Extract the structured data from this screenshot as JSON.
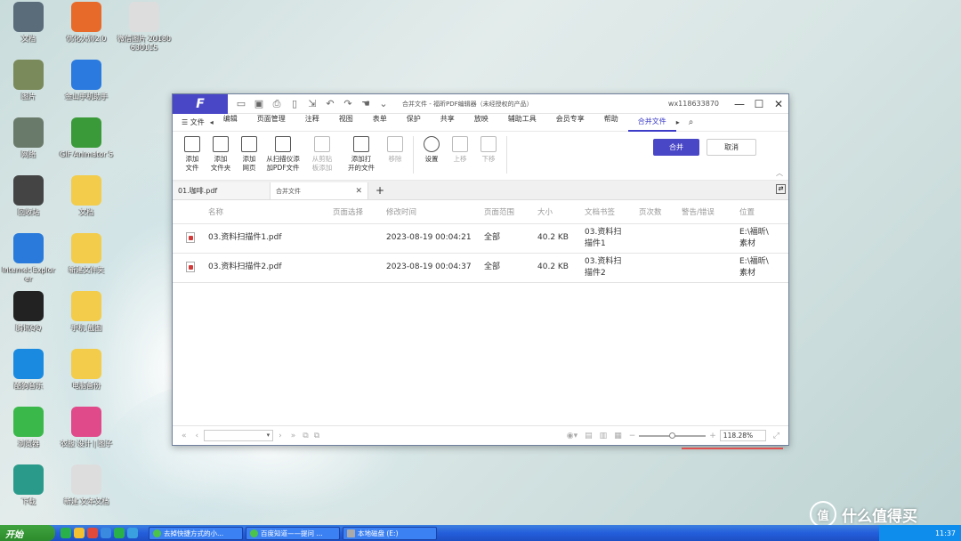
{
  "desktop": {
    "icons": [
      {
        "label": "文档",
        "color": "#5a6b7a",
        "glyph": "computer-icon"
      },
      {
        "label": "图片",
        "color": "#7a8a5a",
        "glyph": "photos-icon"
      },
      {
        "label": "网络",
        "color": "#6a7a6a",
        "glyph": "network-icon"
      },
      {
        "label": "回收站",
        "color": "#444444",
        "glyph": "recycle-bin-icon"
      },
      {
        "label": "Internet Explorer",
        "color": "#2a7adb",
        "glyph": "ie-icon"
      },
      {
        "label": "腾讯QQ",
        "color": "#222222",
        "glyph": "qq-icon"
      },
      {
        "label": "酷狗音乐",
        "color": "#1a8ae0",
        "glyph": "kugou-icon"
      },
      {
        "label": "浏览器",
        "color": "#3bb84a",
        "glyph": "browser-icon"
      },
      {
        "label": "下载",
        "color": "#2a9a8a",
        "glyph": "download-icon"
      },
      {
        "label": "优化大师2.0",
        "color": "#e86a2a",
        "glyph": "browser-icon"
      },
      {
        "label": "金山手机助手",
        "color": "#2a7ae0",
        "glyph": "phone-icon"
      },
      {
        "label": "GIF Animator 5",
        "color": "#3a9a3a",
        "glyph": "gif-icon"
      },
      {
        "label": "文档",
        "color": "#f2cc4a",
        "glyph": "folder-icon"
      },
      {
        "label": "新建文件夹",
        "color": "#f2cc4a",
        "glyph": "folder-icon"
      },
      {
        "label": "手机 截图",
        "color": "#f2cc4a",
        "glyph": "folder-icon"
      },
      {
        "label": "电脑备份",
        "color": "#f2cc4a",
        "glyph": "folder-icon"
      },
      {
        "label": "衣服 设计 | 图子",
        "color": "#e04a8a",
        "glyph": "shirt-icon"
      },
      {
        "label": "新建 文本文档",
        "color": "#dddddd",
        "glyph": "text-file-icon"
      },
      {
        "label": "微信图片 20180630115",
        "color": "#dddddd",
        "glyph": "image-file-icon"
      }
    ]
  },
  "window": {
    "logo": "F",
    "title": "合并文件 - 福昕PDF编辑器（未经授权的产品）",
    "user": "wx118633870",
    "menu": {
      "file": "文件",
      "items": [
        "编辑",
        "页面管理",
        "注释",
        "视图",
        "表单",
        "保护",
        "共享",
        "放映",
        "辅助工具",
        "会员专享",
        "帮助",
        "合并文件"
      ],
      "active_index": 11
    },
    "ribbon": {
      "buttons": [
        {
          "label": "添加\n文件",
          "disabled": false
        },
        {
          "label": "添加\n文件夹",
          "disabled": false
        },
        {
          "label": "添加\n网页",
          "disabled": false
        },
        {
          "label": "从扫描仪添\n加PDF文件",
          "disabled": false
        },
        {
          "label": "从剪贴\n板添加",
          "disabled": true
        },
        {
          "label": "添加打\n开的文件",
          "disabled": false
        },
        {
          "label": "移除",
          "disabled": true
        },
        {
          "label": "设置",
          "disabled": false
        },
        {
          "label": "上移",
          "disabled": true
        },
        {
          "label": "下移",
          "disabled": true
        }
      ],
      "merge": "合并",
      "cancel": "取消"
    },
    "tabs": [
      {
        "label": "01.咖啡.pdf"
      },
      {
        "label": "合并文件"
      }
    ],
    "table": {
      "headers": [
        "名称",
        "页面选择",
        "修改时间",
        "页面范围",
        "大小",
        "文档书签",
        "页次数",
        "警告/错误",
        "位置"
      ],
      "rows": [
        {
          "name": "03.资料扫描件1.pdf",
          "pages": "",
          "modified": "2023-08-19 00:04:21",
          "range": "全部",
          "size": "40.2 KB",
          "bookmark_1": "03.资料扫",
          "bookmark_2": "描件1",
          "count": "",
          "warn": "",
          "location_1": "E:\\福昕\\",
          "location_2": "素材"
        },
        {
          "name": "03.资料扫描件2.pdf",
          "pages": "",
          "modified": "2023-08-19 00:04:37",
          "range": "全部",
          "size": "40.2 KB",
          "bookmark_1": "03.资料扫",
          "bookmark_2": "描件2",
          "count": "",
          "warn": "",
          "location_1": "E:\\福昕\\",
          "location_2": "素材"
        }
      ]
    },
    "status": {
      "zoom": "118.28%"
    }
  },
  "taskbar": {
    "start": "开始",
    "items": [
      "去掉快捷方式的小...",
      "百度知道——提问 ...",
      "本地磁盘 (E:)"
    ],
    "time": "11:37"
  },
  "watermark": {
    "logo": "值",
    "text": "什么值得买"
  }
}
